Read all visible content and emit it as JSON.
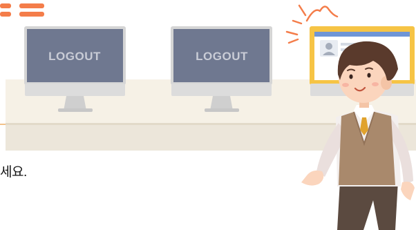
{
  "monitors": [
    {
      "screen_text": "LOGOUT",
      "state": "logged-out"
    },
    {
      "screen_text": "LOGOUT",
      "state": "logged-out"
    },
    {
      "state": "logged-in"
    }
  ],
  "caption": {
    "text": "세요."
  },
  "colors": {
    "accent_orange": "#f47d4a",
    "screen_logout": "#6f7890",
    "screen_active_frame": "#f6c445",
    "desk_top": "#f4efe3",
    "desk_front": "#ddd4c2",
    "vest": "#a9896c",
    "tie": "#e0a22d",
    "hair": "#5a3a2c",
    "pants": "#5b4a40",
    "skin": "#fbd5bd"
  },
  "icons": [
    "burst-lines-icon",
    "avatar-icon"
  ]
}
